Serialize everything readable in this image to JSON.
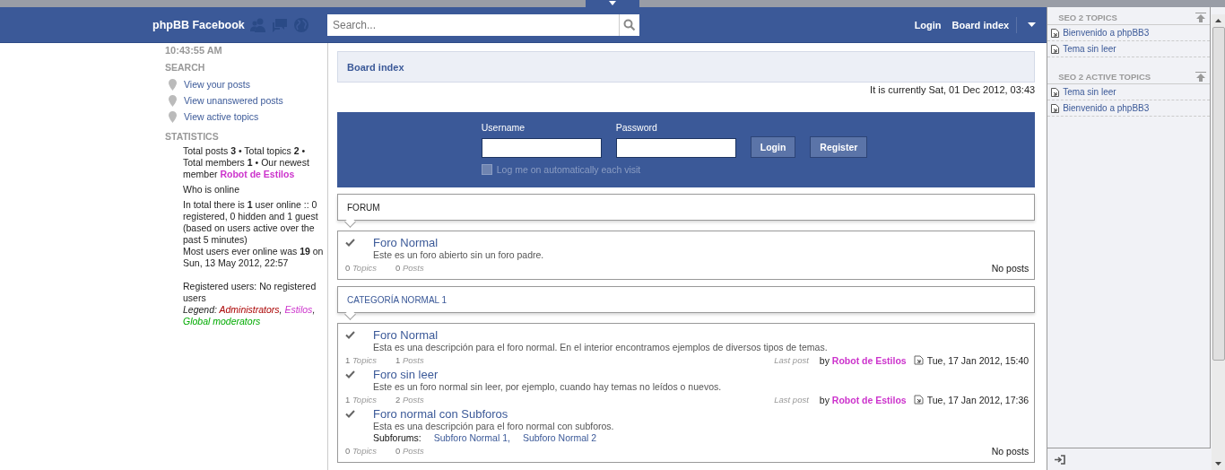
{
  "header": {
    "title": "phpBB Facebook",
    "search": {
      "placeholder": "Search..."
    },
    "nav": [
      {
        "label": "Login"
      },
      {
        "label": "Board index"
      }
    ]
  },
  "sidebar": {
    "clock": "10:43:55 AM",
    "search_heading": "SEARCH",
    "search_links": [
      "View your posts",
      "View unanswered posts",
      "View active topics"
    ],
    "statistics_heading": "STATISTICS",
    "stats": "Total posts **3** • Total topics **2** • Total members **1** • Our newest member",
    "newest_member": {
      "name": "Robot de Estilos",
      "color": "#cc33cc"
    },
    "who_is_online": "Who is online",
    "online_text": "In total there is **1** user online :: 0 registered, 0 hidden and 1 guest (based on users active over the past 5 minutes)",
    "most_users": "Most users ever online was **19** on Sun, 13 May 2012, 22:57",
    "registered": "Registered users: No registered users",
    "legend_label": "Legend:",
    "legend_separator": ",",
    "legend": [
      {
        "label": "Administrators",
        "color": "#aa0000"
      },
      {
        "label": "Estilos",
        "color": "#cc33cc"
      },
      {
        "label": "Global moderators",
        "color": "#00aa00"
      }
    ]
  },
  "breadcrumb": "Board index",
  "current_time": "It is currently Sat, 01 Dec 2012, 03:43",
  "login": {
    "username_label": "Username",
    "password_label": "Password",
    "login_button": "Login",
    "register_button": "Register",
    "remember": {
      "label": "Log me on automatically each visit",
      "checked": false
    }
  },
  "categories": [
    {
      "title": "FORUM",
      "linked": false,
      "forums": [
        {
          "name": "Foro Normal",
          "description": "Este es un foro abierto sin un foro padre.",
          "topics": "0",
          "topics_label": "Topics",
          "posts": "0",
          "posts_label": "Posts",
          "no_posts": "No posts"
        }
      ]
    },
    {
      "title": "CATEGORÍA NORMAL 1",
      "linked": true,
      "forums": [
        {
          "name": "Foro Normal",
          "description": "Esta es una descripción para el foro normal. En el interior encontramos ejemplos de diversos tipos de temas.",
          "topics": "1",
          "topics_label": "Topics",
          "posts": "1",
          "posts_label": "Posts",
          "last_post": {
            "label": "Last post",
            "by": "by",
            "author": "Robot de Estilos",
            "color": "#cc33cc",
            "date": "Tue, 17 Jan 2012, 15:40"
          }
        },
        {
          "name": "Foro sin leer",
          "description": "Este es un foro normal sin leer, por ejemplo, cuando hay temas no leídos o nuevos.",
          "topics": "1",
          "topics_label": "Topics",
          "posts": "2",
          "posts_label": "Posts",
          "last_post": {
            "label": "Last post",
            "by": "by",
            "author": "Robot de Estilos",
            "color": "#cc33cc",
            "date": "Tue, 17 Jan 2012, 17:36"
          }
        },
        {
          "name": "Foro normal con Subforos",
          "description": "Esta es una descripción para el foro normal con subforos.",
          "subforums_label": "Subforums:",
          "subforums": [
            "Subforo Normal 1,",
            "Subforo Normal 2"
          ],
          "topics": "0",
          "topics_label": "Topics",
          "posts": "0",
          "posts_label": "Posts",
          "no_posts": "No posts"
        }
      ]
    }
  ],
  "right_panel": {
    "sections": [
      {
        "title": "SEO 2 TOPICS",
        "items": [
          "Bienvenido a phpBB3",
          "Tema sin leer"
        ]
      },
      {
        "title": "SEO 2 ACTIVE TOPICS",
        "items": [
          "Tema sin leer",
          "Bienvenido a phpBB3"
        ]
      }
    ]
  }
}
